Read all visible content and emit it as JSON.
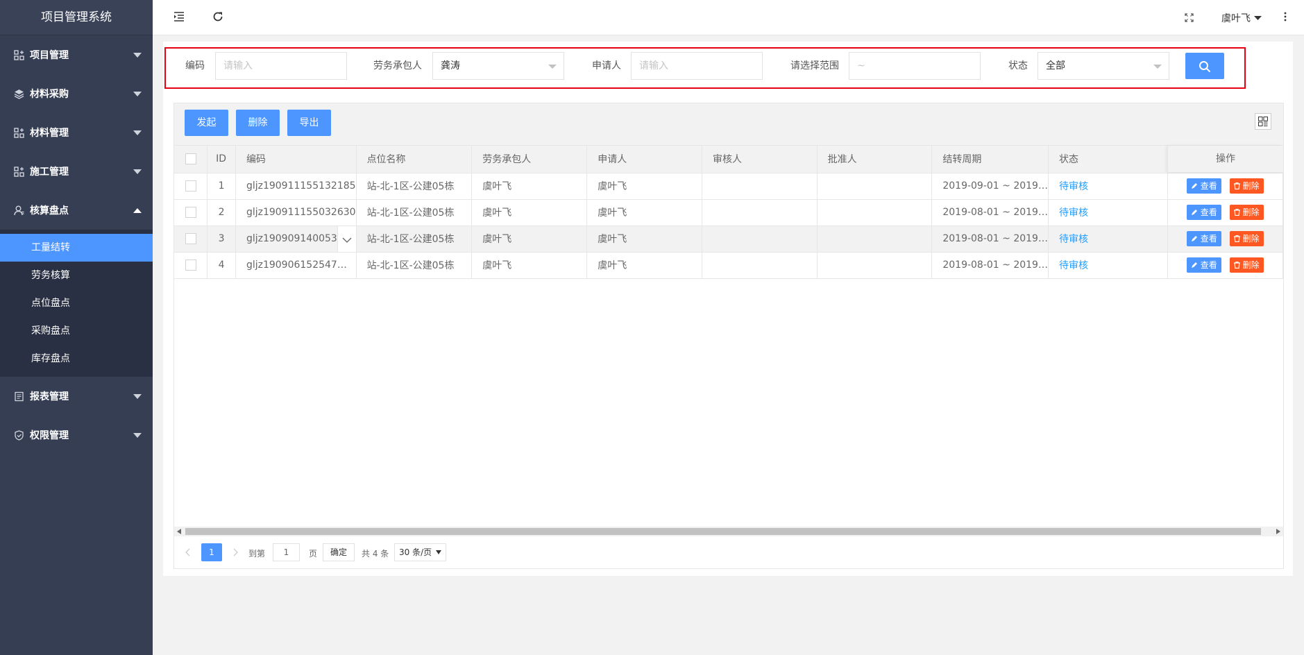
{
  "app": {
    "title": "项目管理系统"
  },
  "sidebar": {
    "groups_top": [
      {
        "label": "项目管理",
        "icon": "grid-icon"
      },
      {
        "label": "材料采购",
        "icon": "layers-icon"
      },
      {
        "label": "材料管理",
        "icon": "grid-icon"
      },
      {
        "label": "施工管理",
        "icon": "grid-icon"
      },
      {
        "label": "核算盘点",
        "icon": "user-icon"
      }
    ],
    "sub_items": [
      {
        "label": "工量结转",
        "active": true
      },
      {
        "label": "劳务核算"
      },
      {
        "label": "点位盘点"
      },
      {
        "label": "采购盘点"
      },
      {
        "label": "库存盘点"
      }
    ],
    "groups_bottom": [
      {
        "label": "报表管理",
        "icon": "report-icon"
      },
      {
        "label": "权限管理",
        "icon": "shield-icon"
      }
    ]
  },
  "header": {
    "user": "虞叶飞"
  },
  "filters": {
    "code_label": "编码",
    "code_placeholder": "请输入",
    "labor_label": "劳务承包人",
    "labor_value": "龚涛",
    "applicant_label": "申请人",
    "applicant_placeholder": "请输入",
    "range_label": "请选择范围",
    "range_placeholder": "~",
    "status_label": "状态",
    "status_value": "全部"
  },
  "toolbar": {
    "start": "发起",
    "delete": "删除",
    "export": "导出"
  },
  "table": {
    "headers": {
      "id": "ID",
      "code": "编码",
      "site": "点位名称",
      "labor": "劳务承包人",
      "applicant": "申请人",
      "reviewer": "审核人",
      "approver": "批准人",
      "period": "结转周期",
      "status": "状态",
      "ops": "操作"
    },
    "rows": [
      {
        "id": "1",
        "code": "gljz190911155132185",
        "site": "站-北-1区-公建05栋",
        "labor": "虞叶飞",
        "applicant": "虞叶飞",
        "reviewer": "",
        "approver": "",
        "period": "2019-09-01 ~ 2019…",
        "status": "待审核"
      },
      {
        "id": "2",
        "code": "gljz190911155032630",
        "site": "站-北-1区-公建05栋",
        "labor": "虞叶飞",
        "applicant": "虞叶飞",
        "reviewer": "",
        "approver": "",
        "period": "2019-08-01 ~ 2019…",
        "status": "待审核"
      },
      {
        "id": "3",
        "code": "gljz190909140053…",
        "site": "站-北-1区-公建05栋",
        "labor": "虞叶飞",
        "applicant": "虞叶飞",
        "reviewer": "",
        "approver": "",
        "period": "2019-08-01 ~ 2019…",
        "status": "待审核"
      },
      {
        "id": "4",
        "code": "gljz190906152547…",
        "site": "站-北-1区-公建05栋",
        "labor": "虞叶飞",
        "applicant": "虞叶飞",
        "reviewer": "",
        "approver": "",
        "period": "2019-08-01 ~ 2019…",
        "status": "待审核"
      }
    ],
    "view_label": "查看",
    "delete_label": "删除"
  },
  "pager": {
    "current": "1",
    "goto_label": "到第",
    "goto_value": "1",
    "page_unit": "页",
    "confirm": "确定",
    "total": "共 4 条",
    "per_page": "30 条/页"
  },
  "colors": {
    "sidebar": "#363e54",
    "accent": "#4d96ff",
    "danger": "#ff5722",
    "highlight_border": "#e60012"
  }
}
